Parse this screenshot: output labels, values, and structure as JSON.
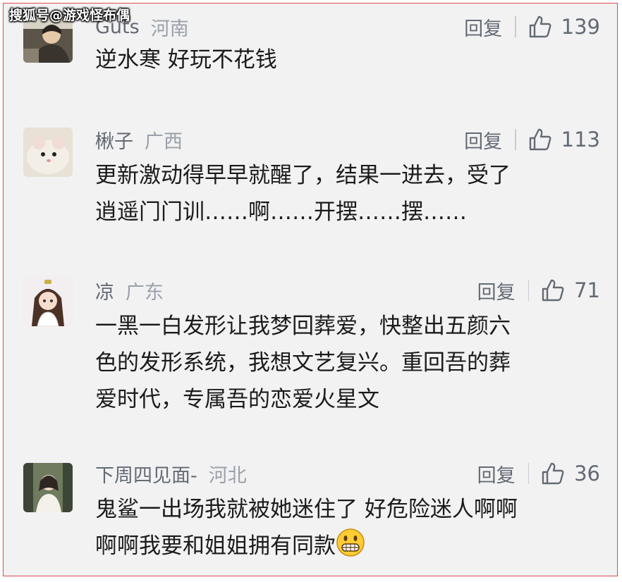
{
  "watermark": "搜狐号@游戏怪布偶",
  "colors": {
    "frame_border": "#e0484f",
    "background": "#f2f2f2",
    "meta_text": "#646a75",
    "region_text": "#9aa0aa",
    "body_text": "#1b1b1b"
  },
  "comments": [
    {
      "user": "Guts",
      "region": "河南",
      "reply_label": "回复",
      "likes": "139",
      "like_icon": "thumbs-up-icon",
      "text": "逆水寒 好玩不花钱"
    },
    {
      "user": "楸子",
      "region": "广西",
      "reply_label": "回复",
      "likes": "113",
      "like_icon": "thumbs-up-icon",
      "text": "更新激动得早早就醒了，结果一进去，受了\n逍遥门门训……啊……开摆……摆……"
    },
    {
      "user": "凉",
      "region": "广东",
      "reply_label": "回复",
      "likes": "71",
      "like_icon": "thumbs-up-icon",
      "text": "一黑一白发形让我梦回葬爱，快整出五颜六\n色的发形系统，我想文艺复兴。重回吾的葬\n爱时代，专属吾的恋爱火星文"
    },
    {
      "user": "下周四见面-",
      "region": "河北",
      "reply_label": "回复",
      "likes": "36",
      "like_icon": "thumbs-up-icon",
      "text": "鬼鲨一出场我就被她迷住了 好危险迷人啊啊\n啊啊我要和姐姐拥有同款",
      "trailing_emoji": "grinning-face-emoji"
    }
  ]
}
